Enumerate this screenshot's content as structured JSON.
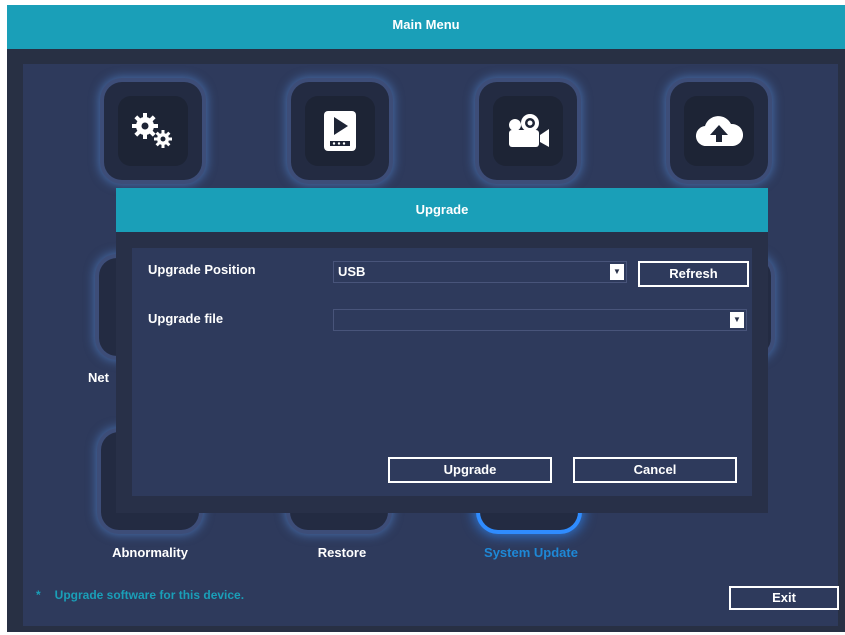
{
  "window": {
    "title": "Main Menu"
  },
  "menu": {
    "top_icons": [
      {
        "name": "gear-icon"
      },
      {
        "name": "playback-icon"
      },
      {
        "name": "camera-icon"
      },
      {
        "name": "cloud-upload-icon"
      }
    ],
    "partial_label": "Net",
    "items_bottom": [
      {
        "label": "Abnormality"
      },
      {
        "label": "Restore"
      },
      {
        "label": "System Update",
        "active": true
      }
    ]
  },
  "hint": {
    "star": "*",
    "text": "Upgrade software for this device."
  },
  "exit_label": "Exit",
  "dialog": {
    "title": "Upgrade",
    "position_label": "Upgrade Position",
    "position_value": "USB",
    "refresh_label": "Refresh",
    "file_label": "Upgrade file",
    "file_value": "",
    "upgrade_label": "Upgrade",
    "cancel_label": "Cancel"
  },
  "colors": {
    "accent": "#1a9fb8",
    "background": "#2e3a5c",
    "active": "#2f8cff"
  }
}
